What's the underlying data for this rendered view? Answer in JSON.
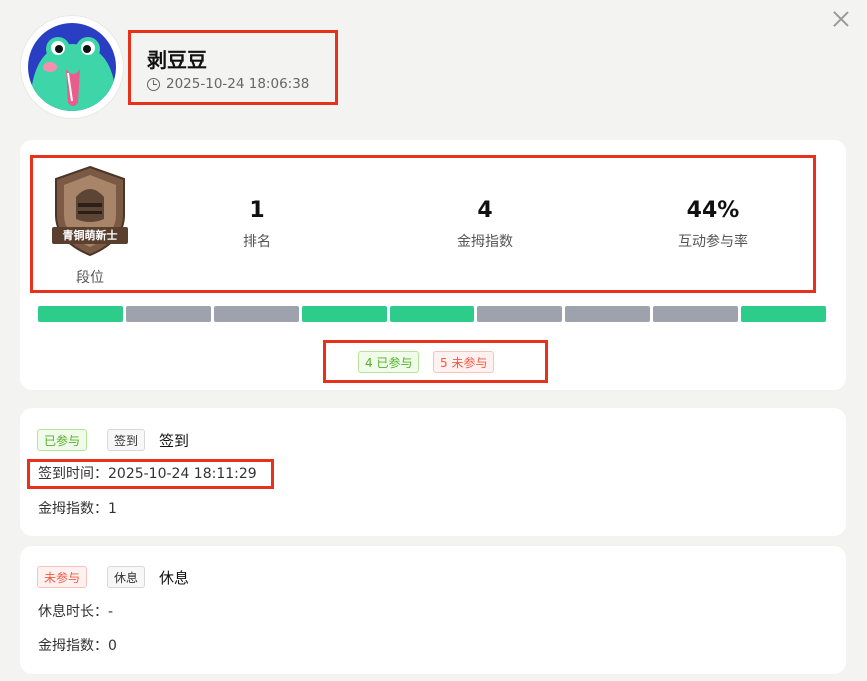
{
  "header": {
    "name": "剥豆豆",
    "timestamp": "2025-10-24 18:06:38"
  },
  "rank_badge": {
    "text": "青铜萌新士",
    "label": "段位"
  },
  "stats": [
    {
      "value": "1",
      "label": "排名"
    },
    {
      "value": "4",
      "label": "金拇指数"
    },
    {
      "value": "44%",
      "label": "互动参与率"
    }
  ],
  "progress_segments": [
    "done",
    "todo",
    "todo",
    "done",
    "done",
    "todo",
    "todo",
    "todo",
    "done"
  ],
  "colors": {
    "done": "#2ecc8a",
    "todo": "#9da2ad",
    "highlight": "#e8311a"
  },
  "summary": {
    "joined": "4 已参与",
    "not_joined": "5 未参与"
  },
  "activities": [
    {
      "status": "已参与",
      "type_tag": "签到",
      "title": "签到",
      "line1": "签到时间：2025-10-24 18:11:29",
      "line2": "金拇指数：1"
    },
    {
      "status": "未参与",
      "type_tag": "休息",
      "title": "休息",
      "line1": "休息时长：-",
      "line2": "金拇指数：0"
    }
  ]
}
